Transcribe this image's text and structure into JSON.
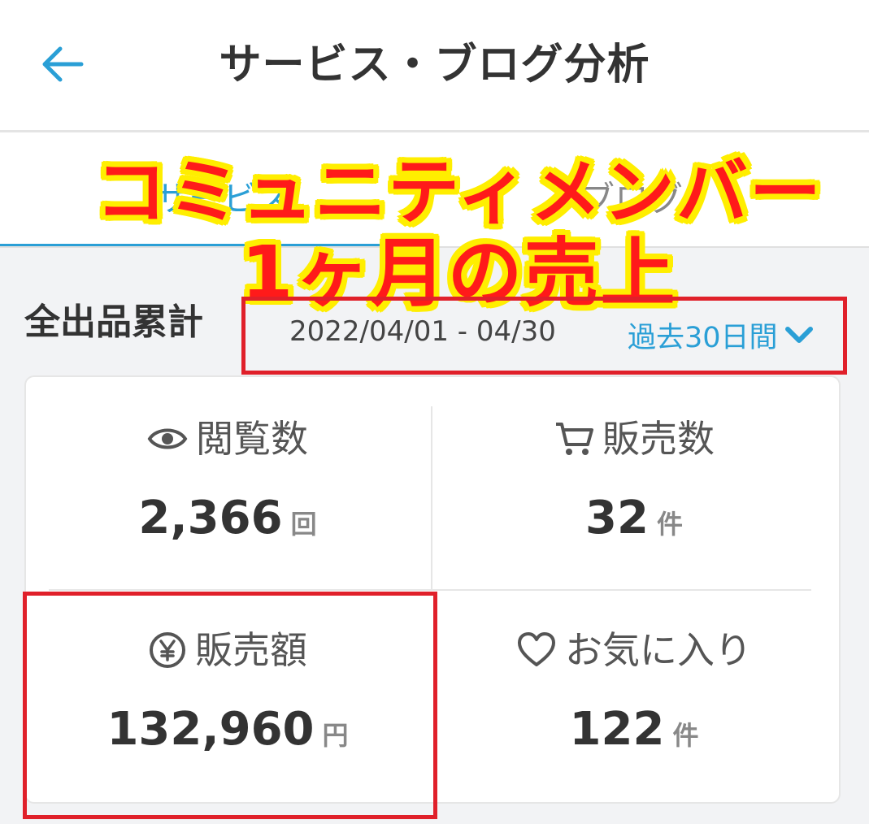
{
  "header": {
    "title": "サービス・ブログ分析"
  },
  "tabs": [
    {
      "label": "サービス"
    },
    {
      "label": "ブログ"
    }
  ],
  "overlay": {
    "line1": "コミュニティメンバー",
    "line2": "1ヶ月の売上"
  },
  "summary": {
    "title": "全出品累計",
    "date_range": "2022/04/01 - 04/30",
    "period_label": "過去30日間"
  },
  "stats": {
    "views": {
      "label": "閲覧数",
      "value": "2,366",
      "unit": "回",
      "icon": "eye-icon"
    },
    "sales": {
      "label": "販売数",
      "value": "32",
      "unit": "件",
      "icon": "cart-icon"
    },
    "revenue": {
      "label": "販売額",
      "value": "132,960",
      "unit": "円",
      "icon": "yen-icon"
    },
    "favorites": {
      "label": "お気に入り",
      "value": "122",
      "unit": "件",
      "icon": "heart-icon"
    }
  },
  "colors": {
    "accent": "#2a9fd6",
    "highlight_border": "#e0202a",
    "overlay_text": "#ff1a1a",
    "overlay_outline": "#ffee00"
  }
}
